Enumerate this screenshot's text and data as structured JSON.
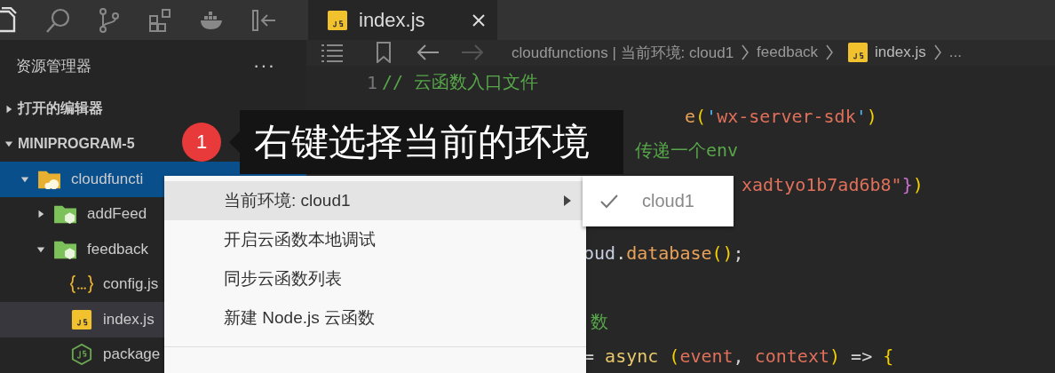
{
  "tabs": [
    {
      "label": "index.js",
      "kind": "js",
      "selected": true
    }
  ],
  "sidebar": {
    "title": "资源管理器",
    "more": "···",
    "tree": [
      {
        "label": "打开的编辑器",
        "kind": "section",
        "expanded": false,
        "selected": false
      },
      {
        "label": "MINIPROGRAM-5",
        "kind": "section",
        "expanded": true,
        "selected": false,
        "children": [
          {
            "label": "cloudfuncti",
            "kind": "cloud-folder",
            "expanded": true,
            "selected": true,
            "children": [
              {
                "label": "addFeed",
                "kind": "function-folder",
                "expanded": false,
                "selected": false
              },
              {
                "label": "feedback",
                "kind": "function-folder",
                "expanded": true,
                "selected": false,
                "children": [
                  {
                    "label": "config.js",
                    "kind": "json",
                    "selected": false,
                    "active": false
                  },
                  {
                    "label": "index.js",
                    "kind": "js",
                    "selected": false,
                    "active": true
                  },
                  {
                    "label": "package",
                    "kind": "node",
                    "selected": false,
                    "active": false
                  }
                ]
              }
            ]
          }
        ]
      }
    ]
  },
  "breadcrumb": [
    {
      "label": "cloudfunctions | 当前环境: cloud1",
      "kind": "folder"
    },
    {
      "label": "feedback",
      "kind": "folder"
    },
    {
      "label": "index.js",
      "kind": "js"
    },
    {
      "label": "...",
      "kind": "more"
    }
  ],
  "code": [
    {
      "number": "1",
      "tokens": [
        {
          "text": "// 云函数入口文件",
          "kind": "comment"
        }
      ]
    },
    {
      "tokens": [
        {
          "text": "e",
          "kind": "function"
        },
        {
          "text": "(",
          "kind": "paren"
        },
        {
          "text": "'",
          "kind": "quote"
        },
        {
          "text": "wx-server-sdk",
          "kind": "string"
        },
        {
          "text": "'",
          "kind": "quote"
        },
        {
          "text": ")",
          "kind": "paren"
        }
      ]
    },
    {
      "tokens": [
        {
          "text": "传递一个env",
          "kind": "comment"
        }
      ]
    },
    {
      "tokens": [
        {
          "text": "xadtyo1b7ad6b8\"",
          "kind": "string"
        },
        {
          "text": "}",
          "kind": "brace"
        },
        {
          "text": ")",
          "kind": "paren"
        }
      ]
    },
    {
      "tokens": [
        {
          "text": "oud",
          "kind": "variable"
        },
        {
          "text": ".",
          "kind": "punct"
        },
        {
          "text": "database",
          "kind": "function"
        },
        {
          "text": "()",
          "kind": "paren"
        },
        {
          "text": ";",
          "kind": "punct"
        }
      ]
    },
    {
      "tokens": [
        {
          "text": "数",
          "kind": "comment"
        }
      ]
    },
    {
      "tokens": [
        {
          "text": "= ",
          "kind": "punct"
        },
        {
          "text": "async ",
          "kind": "keyword"
        },
        {
          "text": "(",
          "kind": "paren"
        },
        {
          "text": "event",
          "kind": "param"
        },
        {
          "text": ", ",
          "kind": "punct"
        },
        {
          "text": "context",
          "kind": "param"
        },
        {
          "text": ")",
          "kind": "paren"
        },
        {
          "text": " => ",
          "kind": "punct"
        },
        {
          "text": "{",
          "kind": "paren"
        }
      ]
    }
  ],
  "context_menu": {
    "items": [
      {
        "label": "当前环境: cloud1",
        "selected": true,
        "submenu": true
      },
      {
        "label": "开启云函数本地调试",
        "selected": false,
        "submenu": false
      },
      {
        "label": "同步云函数列表",
        "selected": false,
        "submenu": false
      },
      {
        "label": "新建 Node.js 云函数",
        "selected": false,
        "submenu": false
      }
    ],
    "submenu": [
      {
        "label": "cloud1",
        "checked": true
      }
    ]
  },
  "callout": {
    "badge": "1",
    "text": "右键选择当前的环境"
  }
}
